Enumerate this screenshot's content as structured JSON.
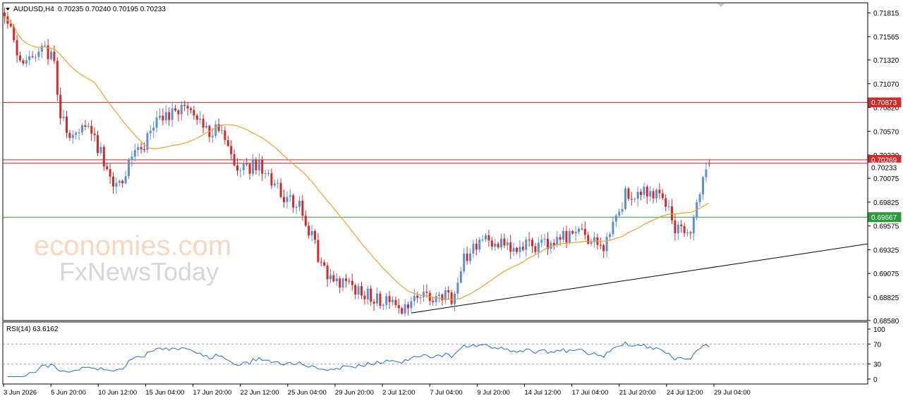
{
  "header": {
    "symbol_label": "AUDUSD,H4",
    "ohlc_text": "0.70235 0.70240 0.70195 0.70233",
    "menu_icon": "triangle-down-icon"
  },
  "watermark": {
    "line1": "economies.com",
    "line2": "FxNewsToday"
  },
  "colors": {
    "bull_candle": "#5b8fd6",
    "bear_candle": "#d12a2a",
    "moving_average": "#f0a030",
    "resistance_line": "#cc2020",
    "support_line": "#2a9a3a",
    "trendline": "#000000",
    "rsi_line": "#1e6fd9",
    "grid": "#d8d8d8",
    "price_tag_red": "#d22b2b",
    "price_tag_green": "#2a9a3a"
  },
  "chart_data": {
    "type": "candlestick",
    "symbol": "AUDUSD",
    "timeframe": "H4",
    "y_range": [
      0.6858,
      0.7192
    ],
    "y_ticks": [
      "0.71815",
      "0.71565",
      "0.71320",
      "0.71070",
      "0.70820",
      "0.70570",
      "0.70320",
      "0.70075",
      "0.69825",
      "0.69575",
      "0.69325",
      "0.69075",
      "0.68825",
      "0.68580"
    ],
    "x_tick_labels": [
      "3 Jun 2026",
      "5 Jun 20:00",
      "10 Jun 12:00",
      "15 Jun 04:00",
      "17 Jun 20:00",
      "22 Jun 12:00",
      "25 Jun 04:00",
      "29 Jun 20:00",
      "2 Jul 12:00",
      "7 Jul 04:00",
      "9 Jul 20:00",
      "14 Jul 12:00",
      "17 Jul 04:00",
      "21 Jul 20:00",
      "24 Jul 12:00",
      "29 Jul 04:00"
    ],
    "candle_count": 228,
    "price_anchors": [
      [
        0,
        0.7183
      ],
      [
        4,
        0.714
      ],
      [
        8,
        0.7132
      ],
      [
        12,
        0.7145
      ],
      [
        16,
        0.7133
      ],
      [
        18,
        0.707
      ],
      [
        22,
        0.705
      ],
      [
        26,
        0.706
      ],
      [
        30,
        0.704
      ],
      [
        36,
        0.6998
      ],
      [
        44,
        0.704
      ],
      [
        50,
        0.707
      ],
      [
        56,
        0.708
      ],
      [
        62,
        0.7072
      ],
      [
        66,
        0.7058
      ],
      [
        70,
        0.706
      ],
      [
        75,
        0.702
      ],
      [
        82,
        0.702
      ],
      [
        88,
        0.6995
      ],
      [
        96,
        0.6975
      ],
      [
        100,
        0.6935
      ],
      [
        104,
        0.69
      ],
      [
        110,
        0.6898
      ],
      [
        116,
        0.6885
      ],
      [
        122,
        0.688
      ],
      [
        128,
        0.6868
      ],
      [
        131,
        0.688
      ],
      [
        138,
        0.6885
      ],
      [
        144,
        0.6882
      ],
      [
        148,
        0.6925
      ],
      [
        155,
        0.694
      ],
      [
        162,
        0.6935
      ],
      [
        168,
        0.694
      ],
      [
        176,
        0.6935
      ],
      [
        182,
        0.695
      ],
      [
        188,
        0.6945
      ],
      [
        193,
        0.693
      ],
      [
        196,
        0.696
      ],
      [
        200,
        0.699
      ],
      [
        206,
        0.6995
      ],
      [
        212,
        0.6985
      ],
      [
        216,
        0.6955
      ],
      [
        220,
        0.6945
      ],
      [
        222,
        0.696
      ],
      [
        225,
        0.7015
      ],
      [
        227,
        0.70233
      ]
    ],
    "levels": [
      {
        "kind": "resistance",
        "price": 0.70873,
        "label": "0.70873"
      },
      {
        "kind": "resistance",
        "price": 0.70269,
        "label": "0.70269"
      },
      {
        "kind": "current",
        "price": 0.70233,
        "label": "0.70233"
      },
      {
        "kind": "support",
        "price": 0.69667,
        "label": "0.69667"
      }
    ],
    "trendline": {
      "start": [
        131,
        0.6866
      ],
      "end": [
        287,
        0.6943
      ]
    },
    "moving_average": {
      "type": "SMA",
      "shown": true
    },
    "rsi": {
      "label": "RSI(14) 63.6162",
      "period": 14,
      "value": 63.6162,
      "y_range": [
        0,
        100
      ],
      "tick_labels": [
        "100",
        "70",
        "30",
        "0"
      ],
      "levels": [
        70,
        30
      ]
    },
    "grid": false,
    "legend": "top-left"
  }
}
